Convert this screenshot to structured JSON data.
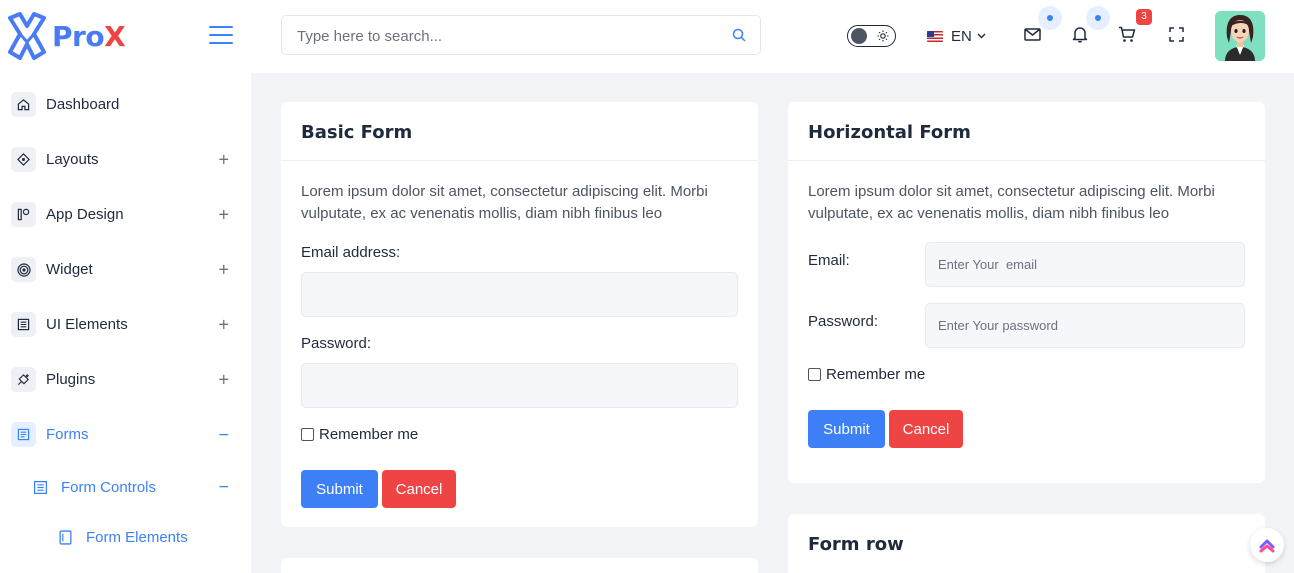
{
  "brand": {
    "name_part1": "Pro",
    "name_part2": "X",
    "primary_color": "#3b82f6",
    "danger_color": "#ef4444"
  },
  "sidebar": {
    "items": [
      {
        "label": "Dashboard",
        "icon": "home-icon",
        "toggle": ""
      },
      {
        "label": "Layouts",
        "icon": "diamond-icon",
        "toggle": "+"
      },
      {
        "label": "App Design",
        "icon": "app-design-icon",
        "toggle": "+"
      },
      {
        "label": "Widget",
        "icon": "target-icon",
        "toggle": "+"
      },
      {
        "label": "UI Elements",
        "icon": "ui-elements-icon",
        "toggle": "+"
      },
      {
        "label": "Plugins",
        "icon": "plug-icon",
        "toggle": "+"
      },
      {
        "label": "Forms",
        "icon": "forms-icon",
        "toggle": "−",
        "active": true
      }
    ],
    "submenu": {
      "label": "Form Controls",
      "icon": "form-controls-icon",
      "toggle": "−"
    },
    "subsubmenu": {
      "label": "Form Elements",
      "icon": "document-icon"
    }
  },
  "header": {
    "search_placeholder": "Type here to search...",
    "language": "EN",
    "cart_count": "3"
  },
  "basic_form": {
    "title": "Basic Form",
    "description": "Lorem ipsum dolor sit amet, consectetur adipiscing elit. Morbi vulputate, ex ac venenatis mollis, diam nibh finibus leo",
    "email_label": "Email address:",
    "email_value": "",
    "password_label": "Password:",
    "password_value": "",
    "remember_label": "Remember me",
    "submit_label": "Submit",
    "cancel_label": "Cancel"
  },
  "horizontal_form": {
    "title": "Horizontal Form",
    "description": "Lorem ipsum dolor sit amet, consectetur adipiscing elit. Morbi vulputate, ex ac venenatis mollis, diam nibh finibus leo",
    "email_label": "Email:",
    "email_placeholder": "Enter Your  email",
    "password_label": "Password:",
    "password_placeholder": "Enter Your password",
    "remember_label": "Remember me",
    "submit_label": "Submit",
    "cancel_label": "Cancel"
  },
  "form_row": {
    "title": "Form row"
  }
}
